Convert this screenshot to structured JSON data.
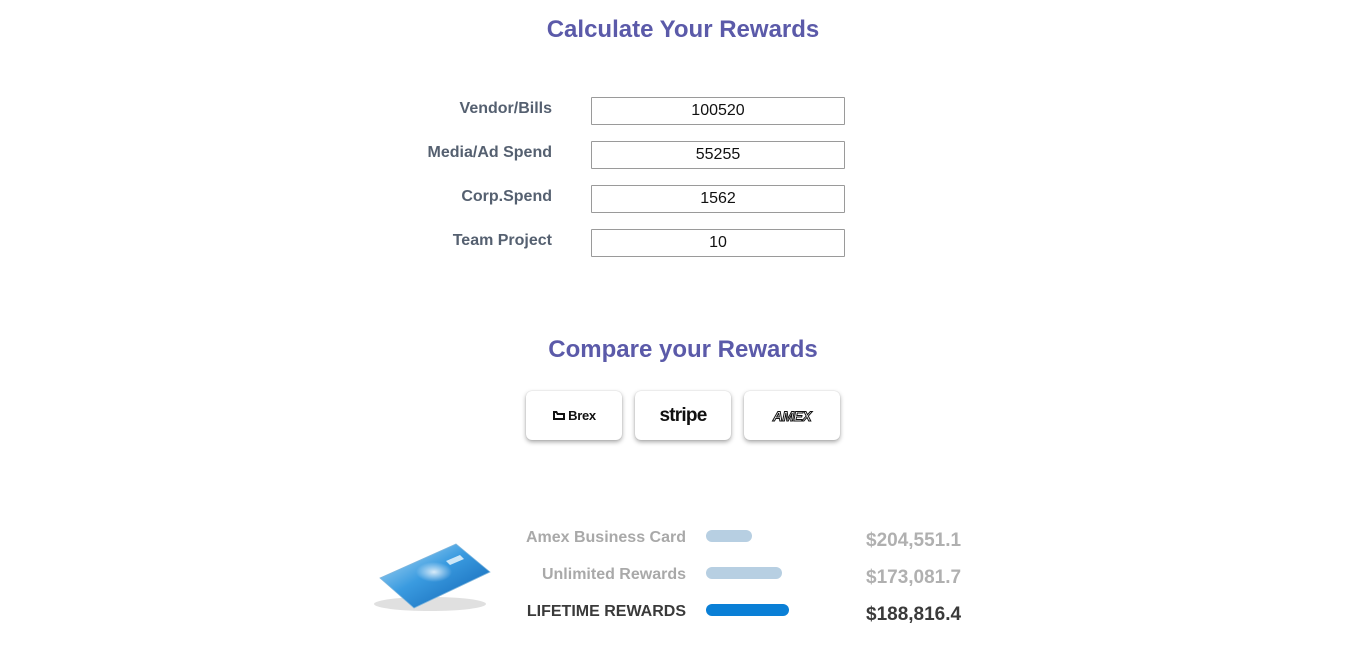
{
  "calculator": {
    "title": "Calculate Your Rewards",
    "fields": [
      {
        "label": "Vendor/Bills",
        "value": "100520"
      },
      {
        "label": "Media/Ad Spend",
        "value": "55255"
      },
      {
        "label": "Corp.Spend",
        "value": "1562"
      },
      {
        "label": "Team Project",
        "value": "10"
      }
    ]
  },
  "compare": {
    "title": "Compare your Rewards",
    "providers": [
      {
        "name": "Brex",
        "icon": "brex-logo-icon"
      },
      {
        "name": "stripe",
        "icon": "stripe-logo-icon"
      },
      {
        "name": "AMEX",
        "icon": "amex-logo-icon"
      }
    ]
  },
  "results": {
    "card_icon": "credit-card-image",
    "colors": {
      "bar_light": "#b7cfe2",
      "bar_strong": "#0a7fd6",
      "title": "#5b5aa9"
    },
    "rows": [
      {
        "label": "Amex Business Card",
        "value": "$204,551.1",
        "bar_fraction": 0.46
      },
      {
        "label": "Unlimited Rewards",
        "value": "$173,081.7",
        "bar_fraction": 0.76
      },
      {
        "label": "LIFETIME REWARDS",
        "value": "$188,816.4",
        "bar_fraction": 0.83
      }
    ]
  }
}
